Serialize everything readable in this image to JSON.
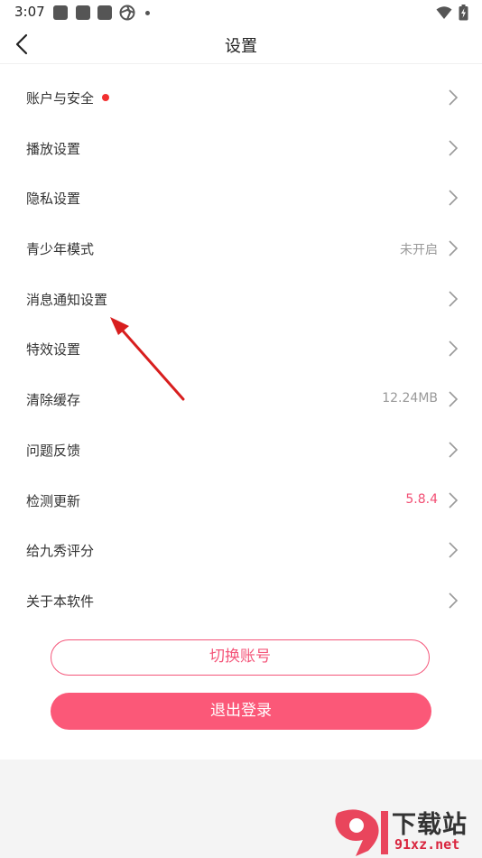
{
  "status_bar": {
    "time": "3:07"
  },
  "header": {
    "title": "设置",
    "back_icon": "chevron-left-icon"
  },
  "settings": {
    "items": [
      {
        "label": "账户与安全",
        "value": "",
        "has_badge": true
      },
      {
        "label": "播放设置",
        "value": ""
      },
      {
        "label": "隐私设置",
        "value": ""
      },
      {
        "label": "青少年模式",
        "value": "未开启"
      },
      {
        "label": "消息通知设置",
        "value": ""
      },
      {
        "label": "特效设置",
        "value": ""
      },
      {
        "label": "清除缓存",
        "value": "12.24MB"
      },
      {
        "label": "问题反馈",
        "value": ""
      },
      {
        "label": "检测更新",
        "value": "5.8.4",
        "value_color": "#f24f74"
      },
      {
        "label": "给九秀评分",
        "value": ""
      },
      {
        "label": "关于本软件",
        "value": ""
      }
    ]
  },
  "actions": {
    "switch_account": "切换账号",
    "logout": "退出登录"
  },
  "watermark": {
    "brand": "下载站",
    "url": "91xz.net"
  },
  "colors": {
    "accent": "#fb5878",
    "badge": "#f23030"
  }
}
